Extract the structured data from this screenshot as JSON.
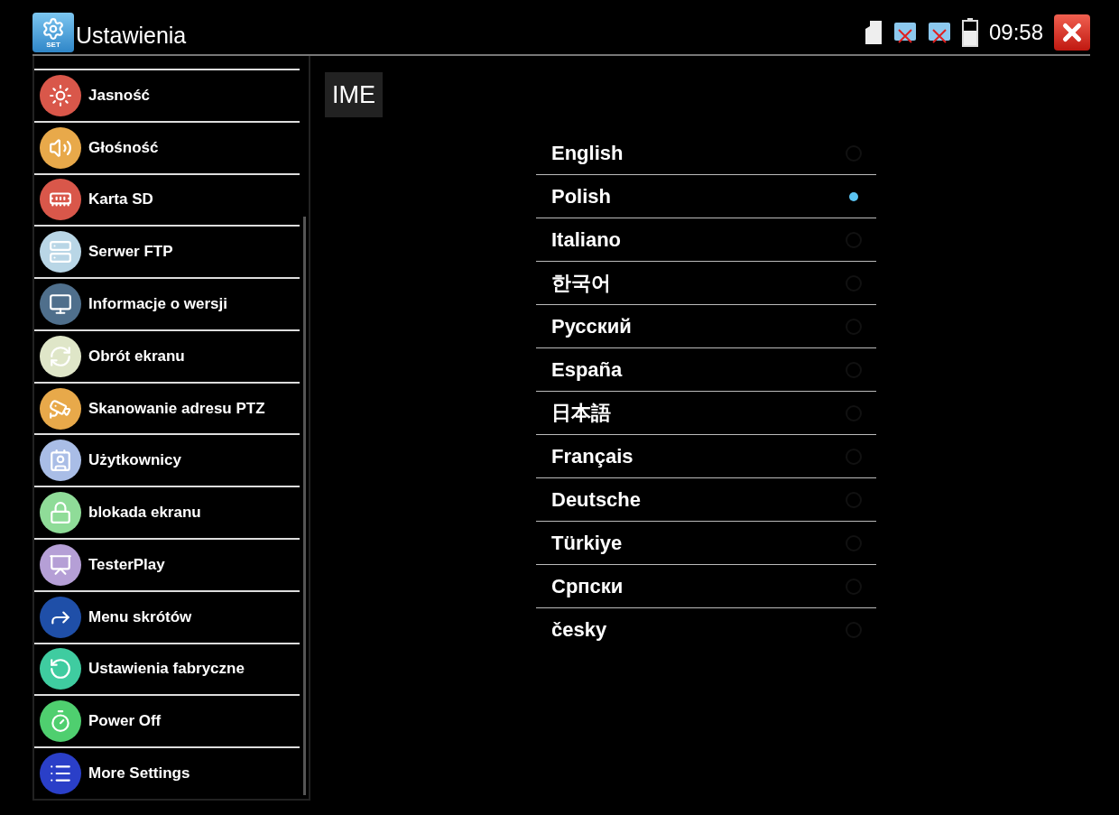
{
  "header": {
    "app_badge": "SET",
    "title": "Ustawienia",
    "time": "09:58"
  },
  "sidebar": {
    "items": [
      {
        "label": "Jasność",
        "color": "#d9574a"
      },
      {
        "label": "Głośność",
        "color": "#e8a94a"
      },
      {
        "label": "Karta SD",
        "color": "#d9574a"
      },
      {
        "label": "Serwer FTP",
        "color": "#b9d6e6"
      },
      {
        "label": "Informacje o wersji",
        "color": "#4f6f8c"
      },
      {
        "label": "Obrót ekranu",
        "color": "#dfe6c8"
      },
      {
        "label": "Skanowanie adresu PTZ",
        "color": "#e8a94a"
      },
      {
        "label": "Użytkownicy",
        "color": "#a9bde6"
      },
      {
        "label": "blokada ekranu",
        "color": "#8fdc98"
      },
      {
        "label": "TesterPlay",
        "color": "#b59fd6"
      },
      {
        "label": "Menu skrótów",
        "color": "#1f4fa8"
      },
      {
        "label": "Ustawienia fabryczne",
        "color": "#3fcca0"
      },
      {
        "label": "Power Off",
        "color": "#4fcf6f"
      },
      {
        "label": "More Settings",
        "color": "#2a3fc8"
      }
    ]
  },
  "section": {
    "title": "IME"
  },
  "languages": [
    {
      "label": "English",
      "selected": false
    },
    {
      "label": "Polish",
      "selected": true
    },
    {
      "label": "Italiano",
      "selected": false
    },
    {
      "label": "한국어",
      "selected": false
    },
    {
      "label": "Русский",
      "selected": false
    },
    {
      "label": "España",
      "selected": false
    },
    {
      "label": "日本語",
      "selected": false
    },
    {
      "label": "Français",
      "selected": false
    },
    {
      "label": "Deutsche",
      "selected": false
    },
    {
      "label": "Türkiye",
      "selected": false
    },
    {
      "label": "Српски",
      "selected": false
    },
    {
      "label": "česky",
      "selected": false
    }
  ]
}
